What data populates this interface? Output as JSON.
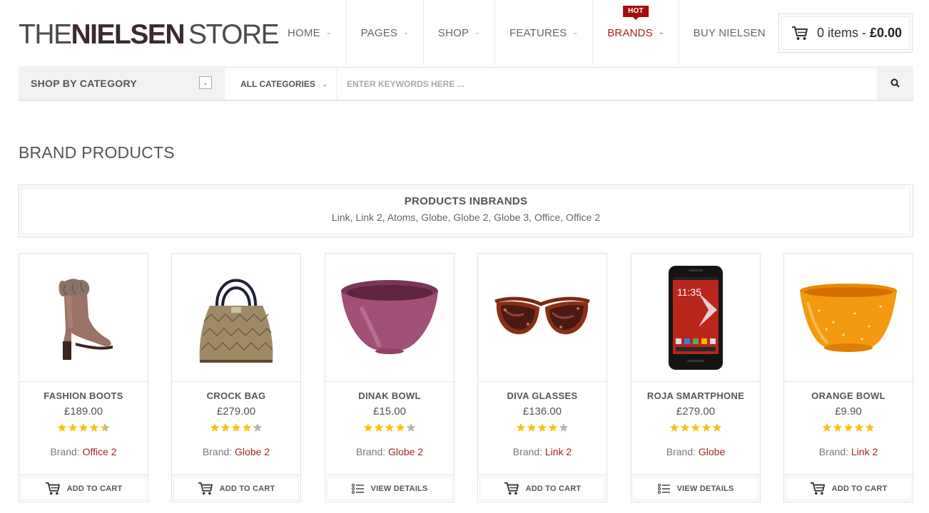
{
  "logo": {
    "part1": "THE",
    "part2": "NIELSEN",
    "part3": "STORE"
  },
  "nav": {
    "items": [
      {
        "label": "HOME",
        "has_dropdown": true
      },
      {
        "label": "PAGES",
        "has_dropdown": true
      },
      {
        "label": "SHOP",
        "has_dropdown": true
      },
      {
        "label": "FEATURES",
        "has_dropdown": true
      },
      {
        "label": "BRANDS",
        "has_dropdown": true,
        "badge": "HOT",
        "active": true
      },
      {
        "label": "BUY NIELSEN",
        "has_dropdown": false
      }
    ]
  },
  "cart": {
    "icon": "cart-icon",
    "items_text": "0 items -",
    "amount": "£0.00"
  },
  "searchbar": {
    "category_label": "SHOP BY CATEGORY",
    "category_toggle_icon": "chevron-down-icon",
    "category_select": "ALL CATEGORIES",
    "search_placeholder": "ENTER KEYWORDS HERE ...",
    "search_icon": "search-icon"
  },
  "page": {
    "title": "BRAND PRODUCTS"
  },
  "brands_box": {
    "heading": "PRODUCTS INBRANDS",
    "list": "Link, Link 2, Atoms, Globe, Globe 2, Globe 3, Office, Office 2"
  },
  "products": [
    {
      "name": "FASHION BOOTS",
      "price": "£189.00",
      "rating": 4.5,
      "brand_label": "Brand:",
      "brand": "Office 2",
      "action": "ADD TO CART",
      "action_icon": "cart-icon",
      "image": "boot-image"
    },
    {
      "name": "CROCK BAG",
      "price": "£279.00",
      "rating": 4,
      "brand_label": "Brand:",
      "brand": "Globe 2",
      "action": "ADD TO CART",
      "action_icon": "cart-icon",
      "image": "handbag-image"
    },
    {
      "name": "DINAK BOWL",
      "price": "£15.00",
      "rating": 4,
      "brand_label": "Brand:",
      "brand": "Globe 2",
      "action": "VIEW DETAILS",
      "action_icon": "list-icon",
      "image": "pink-bowl-image"
    },
    {
      "name": "DIVA GLASSES",
      "price": "£136.00",
      "rating": 4,
      "brand_label": "Brand:",
      "brand": "Link 2",
      "action": "ADD TO CART",
      "action_icon": "cart-icon",
      "image": "sunglasses-image"
    },
    {
      "name": "ROJA SMARTPHONE",
      "price": "£279.00",
      "rating": 5,
      "brand_label": "Brand:",
      "brand": "Globe",
      "action": "VIEW DETAILS",
      "action_icon": "list-icon",
      "image": "smartphone-image"
    },
    {
      "name": "ORANGE BOWL",
      "price": "£9.90",
      "rating": 5,
      "brand_label": "Brand:",
      "brand": "Link 2",
      "action": "ADD TO CART",
      "action_icon": "cart-icon",
      "image": "orange-bowl-image"
    }
  ],
  "colors": {
    "accent": "#a3241f",
    "hot_badge": "#a50c0c",
    "star": "#f5c518",
    "star_empty": "#b5b5b5"
  },
  "phone_screen": {
    "time": "11:35"
  }
}
